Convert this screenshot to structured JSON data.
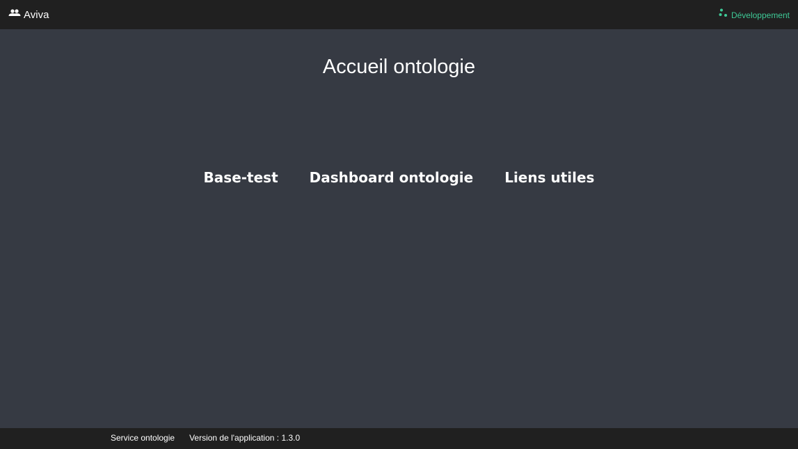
{
  "header": {
    "app_name": "Aviva",
    "app_icon": "users-icon",
    "environment_label": "Développement",
    "environment_icon": "dots-icon",
    "environment_color": "#3ec996"
  },
  "main": {
    "title": "Accueil ontologie",
    "links": [
      {
        "label": "Base-test"
      },
      {
        "label": "Dashboard ontologie"
      },
      {
        "label": "Liens utiles"
      }
    ]
  },
  "footer": {
    "service": "Service ontologie",
    "version": "Version de l'application : 1.3.0"
  },
  "colors": {
    "background": "#363a43",
    "bar": "#202020",
    "text": "#ffffff"
  }
}
